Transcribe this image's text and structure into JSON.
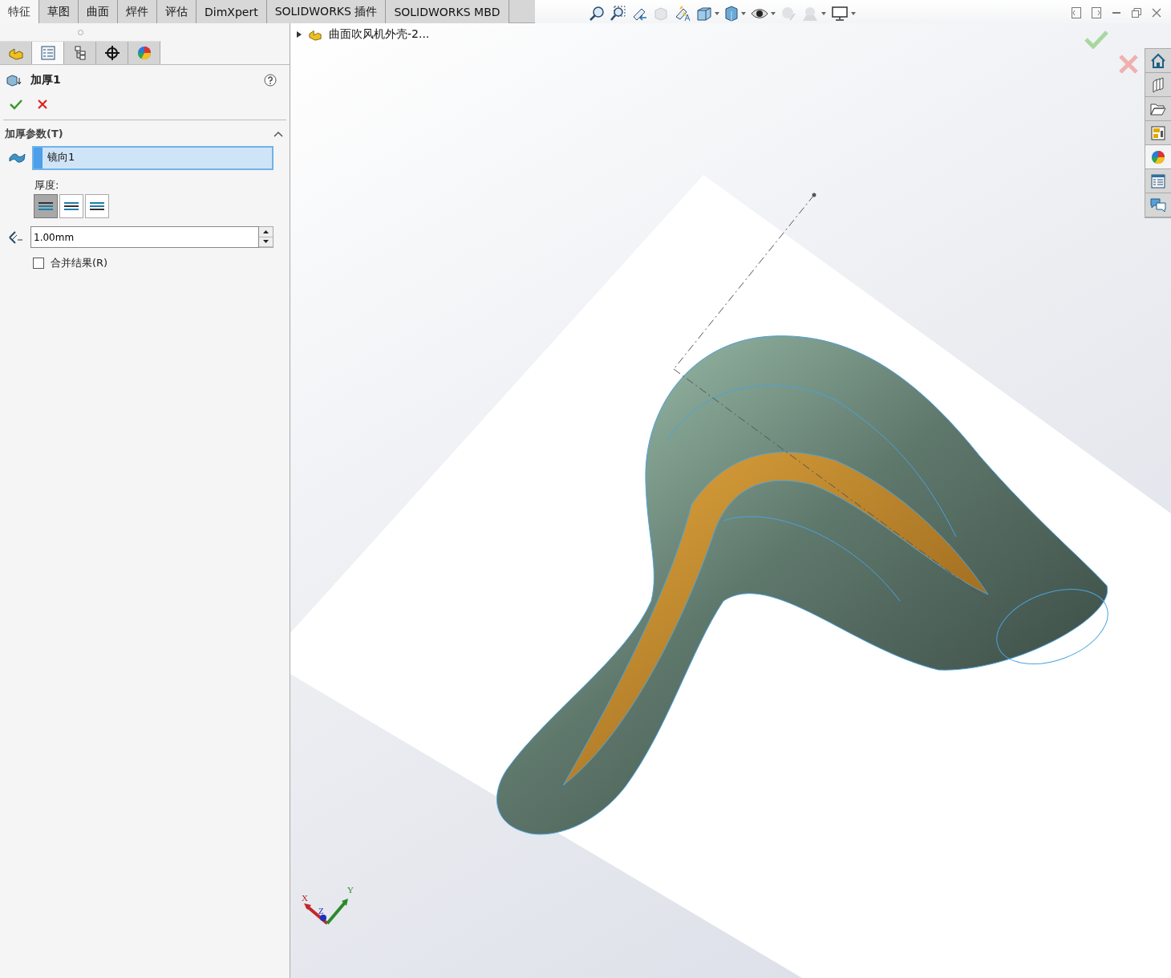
{
  "tabs": [
    {
      "label": "特征",
      "selected": true
    },
    {
      "label": "草图",
      "selected": false
    },
    {
      "label": "曲面",
      "selected": false
    },
    {
      "label": "焊件",
      "selected": false
    },
    {
      "label": "评估",
      "selected": false
    },
    {
      "label": "DimXpert",
      "selected": false
    },
    {
      "label": "SOLIDWORKS 插件",
      "selected": false
    },
    {
      "label": "SOLIDWORKS MBD",
      "selected": false
    }
  ],
  "panel_tabs": [
    {
      "selected": false
    },
    {
      "selected": true
    },
    {
      "selected": false
    },
    {
      "selected": false
    },
    {
      "selected": false
    }
  ],
  "property_manager": {
    "title": "加厚1",
    "section": {
      "title": "加厚参数(T)",
      "expanded": true,
      "face_selection": "镜向1",
      "thickness_label": "厚度:",
      "direction_buttons": [
        {
          "selected": true
        },
        {
          "selected": false
        },
        {
          "selected": false
        }
      ],
      "thickness_value": "1.00mm",
      "merge": {
        "label": "合并结果(R)",
        "checked": false
      }
    }
  },
  "viewport": {
    "tree_item": "曲面吹风机外壳-2...",
    "triad": [
      "X",
      "Y",
      "Z"
    ]
  }
}
